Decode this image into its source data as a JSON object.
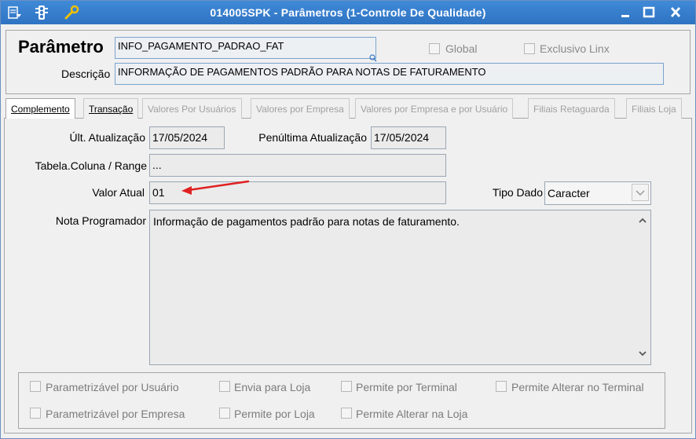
{
  "window": {
    "title": "014005SPK - Parâmetros (1-Controle De Qualidade)"
  },
  "header": {
    "parametro_label": "Parâmetro",
    "parametro_value": "INFO_PAGAMENTO_PADRAO_FAT",
    "descricao_label": "Descrição",
    "descricao_value": "INFORMAÇÃO DE PAGAMENTOS PADRÃO PARA NOTAS DE FATURAMENTO",
    "global_label": "Global",
    "exclusivo_label": "Exclusivo Linx"
  },
  "tabs": [
    {
      "label": "Complemento"
    },
    {
      "label": "Transação"
    },
    {
      "label": "Valores Por Usuários"
    },
    {
      "label": "Valores por Empresa"
    },
    {
      "label": "Valores por Empresa e por Usuário"
    },
    {
      "label": "Filiais Retaguarda"
    },
    {
      "label": "Filiais Loja"
    }
  ],
  "complemento": {
    "ult_atualizacao_label": "Últ. Atualização",
    "ult_atualizacao_value": "17/05/2024",
    "penultima_label": "Penúltima Atualização",
    "penultima_value": "17/05/2024",
    "tabela_label": "Tabela.Coluna / Range",
    "tabela_value": "...",
    "valor_atual_label": "Valor Atual",
    "valor_atual_value": "01",
    "tipo_dado_label": "Tipo Dado",
    "tipo_dado_value": "Caracter",
    "nota_label": "Nota Programador",
    "nota_value": "Informação de pagamentos padrão para notas de faturamento."
  },
  "options": {
    "parametrizavel_usuario": "Parametrizável por Usuário",
    "envia_loja": "Envia para Loja",
    "permite_terminal": "Permite por Terminal",
    "permite_alterar_terminal": "Permite Alterar no Terminal",
    "parametrizavel_empresa": "Parametrizável por Empresa",
    "permite_loja": "Permite por Loja",
    "permite_alterar_loja": "Permite Alterar na Loja"
  },
  "annotation": {
    "arrow_color": "#e02020"
  }
}
